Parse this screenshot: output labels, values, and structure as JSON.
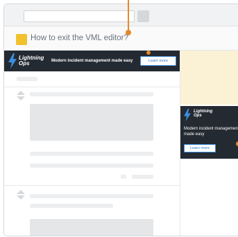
{
  "question": {
    "title": "How to exit the VML editor?",
    "tag_color": "#f2c12e"
  },
  "banner": {
    "brand": "Lightning Ops",
    "tagline": "Modern incident management made easy",
    "cta": "Learn more",
    "bolt_icon": "lightning-bolt-icon",
    "bg_color": "#242a31",
    "accent": "#3b8fe0"
  },
  "sidebar_ad": {
    "brand": "Lightning Ops",
    "tagline": "Modern incident management made easy",
    "cta": "Learn more",
    "bolt_icon": "lightning-bolt-icon"
  },
  "annotation": {
    "color": "#e4882a"
  }
}
